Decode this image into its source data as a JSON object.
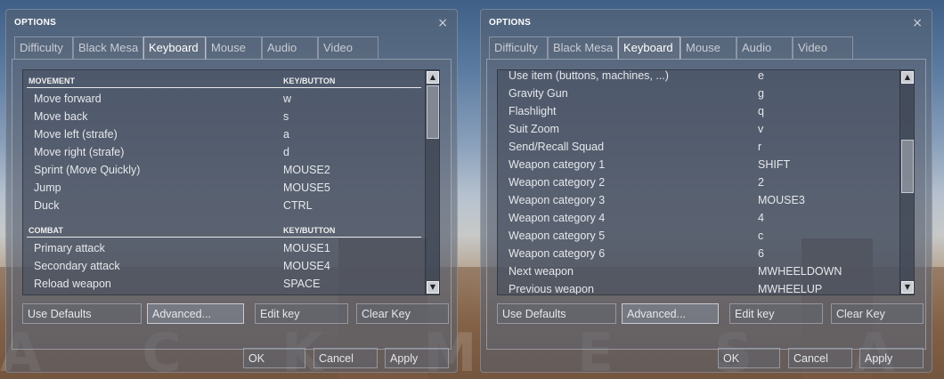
{
  "watermark": "A C K M E S A C K M E S A",
  "dialogs": [
    {
      "title": "OPTIONS",
      "close": "×",
      "tabs": [
        "Difficulty",
        "Black Mesa",
        "Keyboard",
        "Mouse",
        "Audio",
        "Video"
      ],
      "active_tab": "Keyboard",
      "sections": [
        {
          "header": "MOVEMENT",
          "key_header": "KEY/BUTTON",
          "rows": [
            {
              "action": "Move forward",
              "key": "w"
            },
            {
              "action": "Move back",
              "key": "s"
            },
            {
              "action": "Move left (strafe)",
              "key": "a"
            },
            {
              "action": "Move right (strafe)",
              "key": "d"
            },
            {
              "action": "Sprint (Move Quickly)",
              "key": "MOUSE2"
            },
            {
              "action": "Jump",
              "key": "MOUSE5"
            },
            {
              "action": "Duck",
              "key": "CTRL"
            }
          ]
        },
        {
          "header": "COMBAT",
          "key_header": "KEY/BUTTON",
          "rows": [
            {
              "action": "Primary attack",
              "key": "MOUSE1"
            },
            {
              "action": "Secondary attack",
              "key": "MOUSE4"
            },
            {
              "action": "Reload weapon",
              "key": "SPACE"
            }
          ]
        }
      ],
      "buttons": [
        "Use Defaults",
        "Advanced...",
        "Edit key",
        "Clear Key"
      ],
      "footer": [
        "OK",
        "Cancel",
        "Apply"
      ]
    },
    {
      "title": "OPTIONS",
      "close": "×",
      "tabs": [
        "Difficulty",
        "Black Mesa",
        "Keyboard",
        "Mouse",
        "Audio",
        "Video"
      ],
      "active_tab": "Keyboard",
      "rows": [
        {
          "action": "Use item (buttons, machines, ...)",
          "key": "e"
        },
        {
          "action": "Gravity Gun",
          "key": "g"
        },
        {
          "action": "Flashlight",
          "key": "q"
        },
        {
          "action": "Suit Zoom",
          "key": "v"
        },
        {
          "action": "Send/Recall Squad",
          "key": "r"
        },
        {
          "action": "Weapon category 1",
          "key": "SHIFT"
        },
        {
          "action": "Weapon category 2",
          "key": "2"
        },
        {
          "action": "Weapon category 3",
          "key": "MOUSE3"
        },
        {
          "action": "Weapon category 4",
          "key": "4"
        },
        {
          "action": "Weapon category 5",
          "key": "c"
        },
        {
          "action": "Weapon category 6",
          "key": "6"
        },
        {
          "action": "Next weapon",
          "key": "MWHEELDOWN"
        },
        {
          "action": "Previous weapon",
          "key": "MWHEELUP"
        }
      ],
      "buttons": [
        "Use Defaults",
        "Advanced...",
        "Edit key",
        "Clear Key"
      ],
      "footer": [
        "OK",
        "Cancel",
        "Apply"
      ]
    }
  ]
}
